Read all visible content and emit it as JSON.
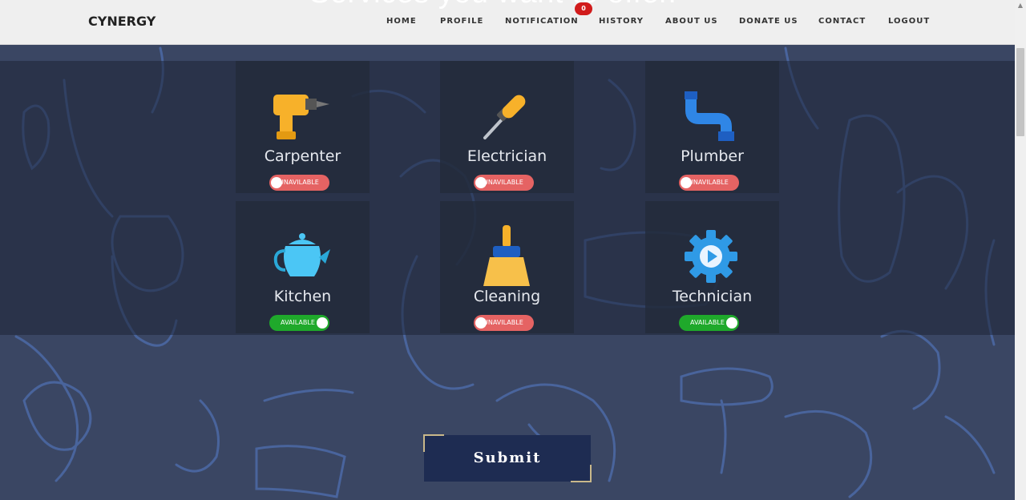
{
  "header": {
    "brand": "CYNERGY",
    "background_title": "Services you want to offer.",
    "nav": {
      "home": "HOME",
      "profile": "PROFILE",
      "notification": "NOTIFICATION",
      "notification_count": "0",
      "history": "HISTORY",
      "about": "ABOUT US",
      "donate": "DONATE US",
      "contact": "CONTACT",
      "logout": "LOGOUT"
    }
  },
  "services": [
    {
      "label": "Carpenter",
      "icon": "drill-icon",
      "status": "UNAVILABLE",
      "available": false
    },
    {
      "label": "Electrician",
      "icon": "screwdriver-icon",
      "status": "UNAVILABLE",
      "available": false
    },
    {
      "label": "Plumber",
      "icon": "pipe-icon",
      "status": "UNAVILABLE",
      "available": false
    },
    {
      "label": "Kitchen",
      "icon": "teapot-icon",
      "status": "AVAILABLE",
      "available": true
    },
    {
      "label": "Cleaning",
      "icon": "broom-icon",
      "status": "UNAVILABLE",
      "available": false
    },
    {
      "label": "Technician",
      "icon": "gear-icon",
      "status": "AVAILABLE",
      "available": true
    }
  ],
  "submit_label": "Submit",
  "colors": {
    "available": "#1fa92b",
    "unavailable": "#e56363",
    "submit_bg": "#1e2c52",
    "page_bg": "#3a4663"
  }
}
